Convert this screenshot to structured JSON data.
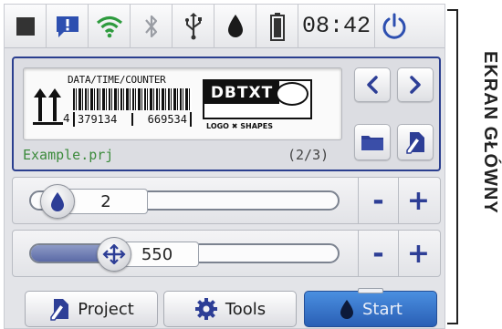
{
  "status_bar": {
    "time": "08:42",
    "icons": [
      "stop-square-icon",
      "alert-message-icon",
      "wifi-icon",
      "bluetooth-icon",
      "usb-icon",
      "ink-drop-icon",
      "battery-icon",
      "power-icon"
    ]
  },
  "project": {
    "label_preview": {
      "header_text": "DATA/TIME/COUNTER",
      "left_number": "4",
      "code_1": "379134",
      "code_2": "669534",
      "logo_text": "DBTXT",
      "logo_caption": "LOGO ✖ SHAPES"
    },
    "file_name": "Example.prj",
    "page_indicator": "(2/3)"
  },
  "sliders": [
    {
      "icon": "ink-drop-icon",
      "value": "2"
    },
    {
      "icon": "arrows-icon",
      "value": "550"
    }
  ],
  "controls": {
    "minus_label": "-",
    "plus_label": "+"
  },
  "bottom_buttons": {
    "project_label": "Project",
    "tools_label": "Tools",
    "start_label": "Start"
  },
  "side_caption": "EKRAN GŁÓWNY",
  "colors": {
    "accent_blue": "#2d3e96",
    "start_blue": "#2a5fb5",
    "file_green": "#3c8b3c",
    "wifi_green": "#2e9b3e"
  }
}
